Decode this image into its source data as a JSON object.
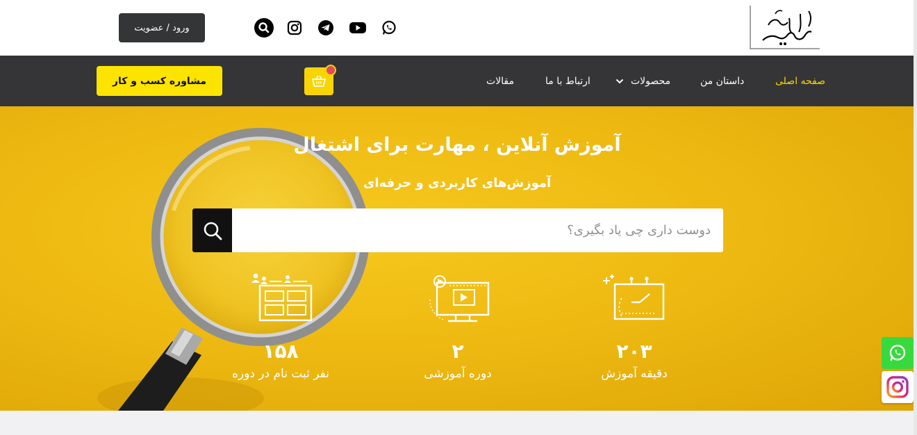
{
  "header": {
    "login_label": "ورود / عضویت",
    "social": [
      "search-icon",
      "instagram-icon",
      "telegram-icon",
      "youtube-icon",
      "whatsapp-icon"
    ],
    "logo_alt": "بهاره حصیبان"
  },
  "nav": {
    "items": [
      {
        "label": "صفحه اصلی",
        "active": true
      },
      {
        "label": "داستان من",
        "active": false
      },
      {
        "label": "محصولات",
        "active": false,
        "has_dropdown": true
      },
      {
        "label": "ارتباط با ما",
        "active": false
      },
      {
        "label": "مقالات",
        "active": false
      }
    ],
    "cart_icon": "basket-icon",
    "consult_label": "مشاوره کسب و کار"
  },
  "hero": {
    "title": "آموزش آنلاین ، مهارت برای اشتغال",
    "subtitle": "آموزش‌های کاربردی و حرفه‌ای",
    "search_placeholder": "دوست داری چی یاد بگیری؟",
    "stats": [
      {
        "value": "۲۰۳",
        "label": "دقیقه آموزش",
        "icon": "clock-board-icon"
      },
      {
        "value": "۲",
        "label": "دوره آموزشی",
        "icon": "video-monitor-icon"
      },
      {
        "value": "۱۵۸",
        "label": "نفر ثبت نام در دوره",
        "icon": "users-board-icon"
      }
    ]
  },
  "colors": {
    "accent": "#f8d500",
    "nav_bg": "#353537",
    "active_link": "#f5d90a",
    "whatsapp": "#38d93e"
  }
}
